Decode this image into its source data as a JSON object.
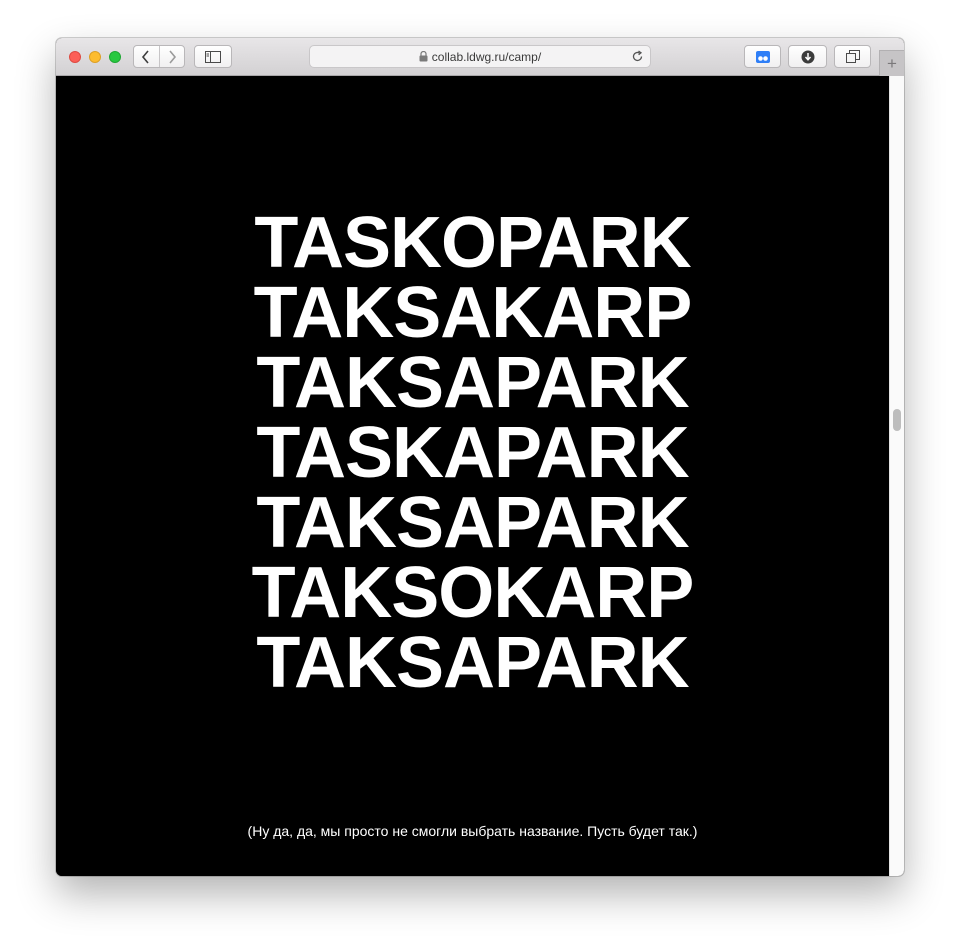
{
  "browser": {
    "url": "collab.ldwg.ru/camp/",
    "new_tab_label": "+",
    "icons": {
      "back": "chevron-left-icon",
      "forward": "chevron-right-icon",
      "sidebar": "sidebar-icon",
      "lock": "lock-icon",
      "reload": "reload-icon",
      "extension": "extension-icon",
      "download": "download-icon",
      "tabs": "tab-overview-icon"
    },
    "colors": {
      "close": "#fc5f57",
      "minimize": "#fdbc2e",
      "maximize": "#28c840",
      "extension_accent": "#2f7ff7"
    }
  },
  "page": {
    "background": "#000000",
    "text_color": "#ffffff",
    "words": [
      "TASKOPARK",
      "TAKSAKARP",
      "TAKSAPARK",
      "TASKAPARK",
      "TAKSAPARK",
      "TAKSOKARP",
      "TAKSAPARK"
    ],
    "caption": "(Ну да, да, мы просто не смогли выбрать название. Пусть будет так.)"
  }
}
